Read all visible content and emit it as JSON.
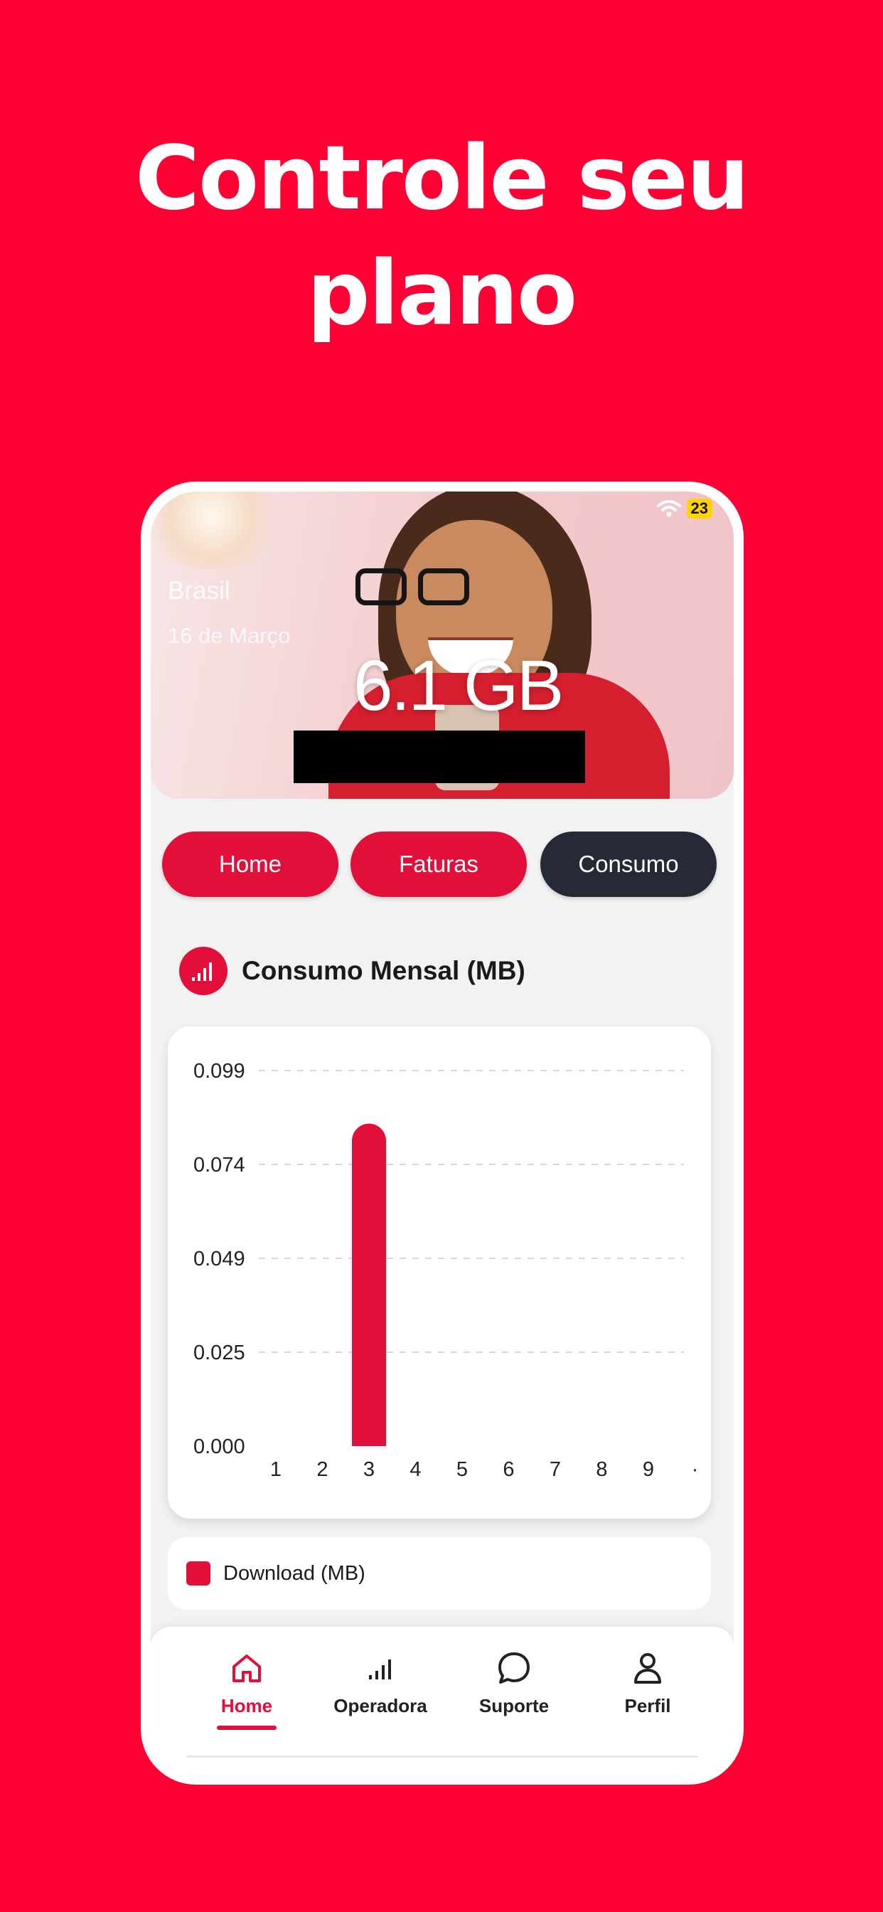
{
  "headline": {
    "line1": "Controle seu",
    "line2": "plano"
  },
  "status_bar": {
    "battery": "23"
  },
  "hero": {
    "country": "Brasil",
    "date": "16 de Março",
    "usage": "6.1 GB"
  },
  "tabs": [
    {
      "label": "Home",
      "active": false
    },
    {
      "label": "Faturas",
      "active": false
    },
    {
      "label": "Consumo",
      "active": true
    }
  ],
  "section": {
    "title": "Consumo Mensal (MB)",
    "icon": "signal-bars-icon"
  },
  "chart_data": {
    "type": "bar",
    "categories": [
      "1",
      "2",
      "3",
      "4",
      "5",
      "6",
      "7",
      "8",
      "9",
      "·"
    ],
    "series": [
      {
        "name": "Download (MB)",
        "values": [
          0,
          0,
          0.085,
          0,
          0,
          0,
          0,
          0,
          0,
          0
        ]
      }
    ],
    "yticks": [
      "0.099",
      "0.074",
      "0.049",
      "0.025",
      "0.000"
    ],
    "ylim": [
      0,
      0.099
    ],
    "grid": true,
    "legend_position": "bottom",
    "color": "#e30f3b"
  },
  "legend": {
    "label": "Download (MB)"
  },
  "bottom_nav": [
    {
      "label": "Home",
      "icon": "home-icon",
      "active": true
    },
    {
      "label": "Operadora",
      "icon": "signal-bars-icon",
      "active": false
    },
    {
      "label": "Suporte",
      "icon": "chat-bubble-icon",
      "active": false
    },
    {
      "label": "Perfil",
      "icon": "person-icon",
      "active": false
    }
  ],
  "colors": {
    "background": "#ff0035",
    "accent": "#e30f3b",
    "dark": "#252a36"
  }
}
